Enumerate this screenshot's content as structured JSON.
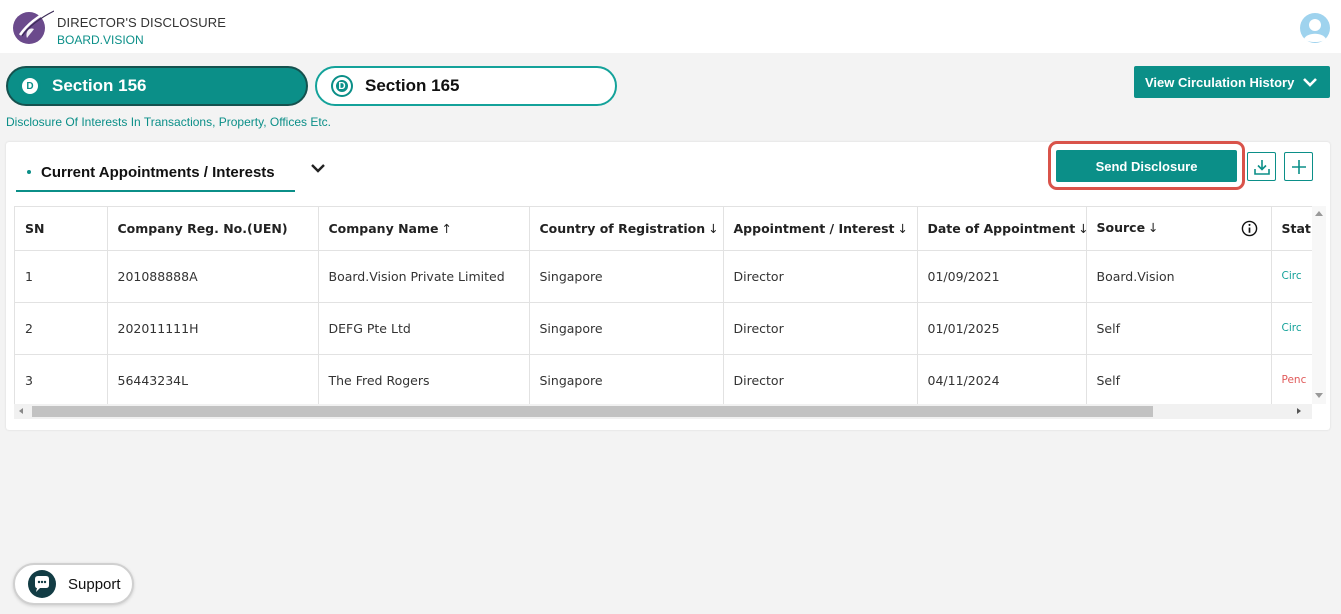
{
  "header": {
    "title": "DIRECTOR'S DISCLOSURE",
    "subtitle": "BOARD.VISION"
  },
  "sections": [
    {
      "badge": "D",
      "label": "Section 156",
      "active": true
    },
    {
      "badge": "D",
      "label": "Section 165",
      "active": false
    }
  ],
  "history_button": {
    "label": "View Circulation History"
  },
  "section_description": "Disclosure Of Interests In Transactions, Property, Offices Etc.",
  "panel": {
    "tab_label": "Current Appointments / Interests",
    "send_button": "Send Disclosure"
  },
  "table": {
    "columns": [
      {
        "label": "SN",
        "arrow": ""
      },
      {
        "label": "Company Reg. No.(UEN)",
        "arrow": ""
      },
      {
        "label": "Company Name",
        "arrow": "↑"
      },
      {
        "label": "Country of Registration",
        "arrow": "↓"
      },
      {
        "label": "Appointment / Interest",
        "arrow": "↓"
      },
      {
        "label": "Date of Appointment",
        "arrow": "↓"
      },
      {
        "label": "Source",
        "arrow": "↓"
      },
      {
        "label": "Stat",
        "arrow": ""
      }
    ],
    "rows": [
      {
        "sn": "1",
        "uen": "201088888A",
        "company": "Board.Vision Private Limited",
        "country": "Singapore",
        "appointment": "Director",
        "date": "01/09/2021",
        "source": "Board.Vision",
        "status": "Circ"
      },
      {
        "sn": "2",
        "uen": "202011111H",
        "company": "DEFG Pte Ltd",
        "country": "Singapore",
        "appointment": "Director",
        "date": "01/01/2025",
        "source": "Self",
        "status": "Circ"
      },
      {
        "sn": "3",
        "uen": "56443234L",
        "company": "The Fred Rogers",
        "country": "Singapore",
        "appointment": "Director",
        "date": "04/11/2024",
        "source": "Self",
        "status": "Penc"
      }
    ]
  },
  "support": {
    "label": "Support"
  },
  "colors": {
    "accent": "#0b8f88",
    "highlight": "#d9534a",
    "pending": "#e05a5a"
  }
}
